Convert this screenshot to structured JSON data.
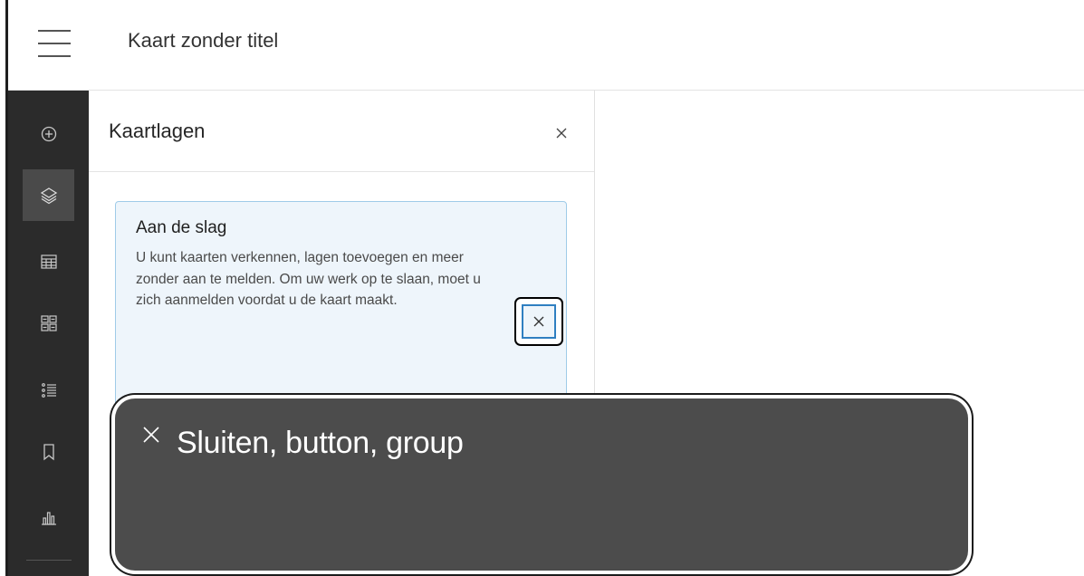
{
  "header": {
    "title": "Kaart zonder titel"
  },
  "action_bar": {
    "items": [
      {
        "icon": "plus-circle-icon"
      },
      {
        "icon": "layers-icon",
        "active": true
      },
      {
        "icon": "table-icon"
      },
      {
        "icon": "grid-icon"
      },
      {
        "icon": "legend-list-icon"
      },
      {
        "icon": "bookmark-icon"
      },
      {
        "icon": "chart-icon"
      }
    ]
  },
  "panel": {
    "title": "Kaartlagen",
    "close_icon": "close-icon",
    "notice": {
      "title": "Aan de slag",
      "body": "U kunt kaarten verkennen, lagen toevoegen en meer zonder aan te melden. Om uw werk op te slaan, moet u zich aanmelden voordat u de kaart maakt."
    }
  },
  "voiceover": {
    "text": "Sluiten, button, group"
  },
  "colors": {
    "action_bar_bg": "#2b2b2b",
    "notice_bg": "#eef5fb",
    "notice_border": "#9fcbe8",
    "focus_blue": "#2f7fc1",
    "caption_bg": "#4c4c4c"
  }
}
